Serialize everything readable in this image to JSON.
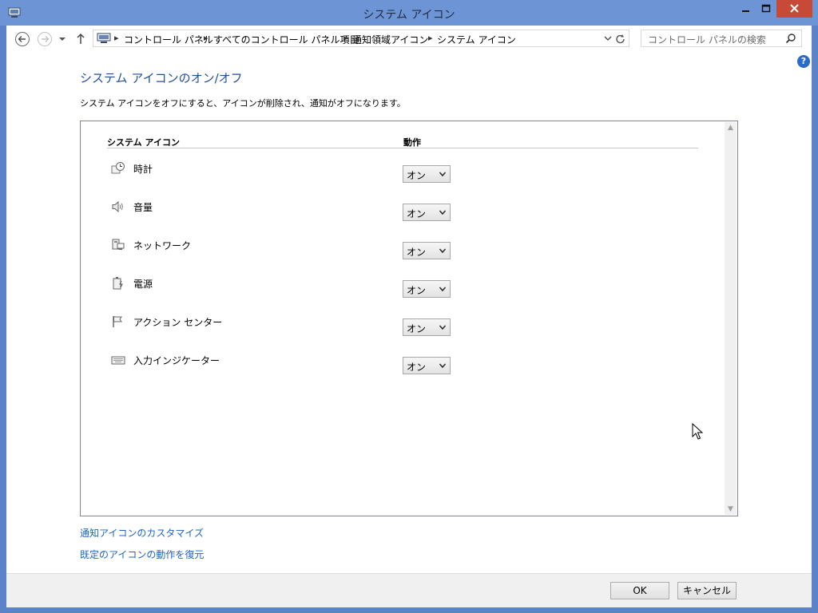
{
  "window": {
    "title": "システム アイコン"
  },
  "breadcrumb": {
    "items": [
      "コントロール パネル",
      "すべてのコントロール パネル項目",
      "通知領域アイコン",
      "システム アイコン"
    ]
  },
  "search": {
    "placeholder": "コントロール パネルの検索"
  },
  "page": {
    "title": "システム アイコンのオン/オフ",
    "description": "システム アイコンをオフにすると、アイコンが削除され、通知がオフになります。"
  },
  "table": {
    "col_icon": "システム アイコン",
    "col_action": "動作",
    "rows": [
      {
        "icon": "clock-icon",
        "label": "時計",
        "value": "オン"
      },
      {
        "icon": "volume-icon",
        "label": "音量",
        "value": "オン"
      },
      {
        "icon": "network-icon",
        "label": "ネットワーク",
        "value": "オン"
      },
      {
        "icon": "power-icon",
        "label": "電源",
        "value": "オン"
      },
      {
        "icon": "action-center-flag-icon",
        "label": "アクション センター",
        "value": "オン"
      },
      {
        "icon": "keyboard-icon",
        "label": "入力インジケーター",
        "value": "オン"
      }
    ]
  },
  "links": {
    "customize": "通知アイコンのカスタマイズ",
    "restore": "既定のアイコンの動作を復元"
  },
  "buttons": {
    "ok": "OK",
    "cancel": "キャンセル"
  },
  "colors": {
    "title_bar": "#6d95d6",
    "link": "#1a64c8",
    "page_title": "#1e4f9c",
    "close": "#c74a37"
  }
}
